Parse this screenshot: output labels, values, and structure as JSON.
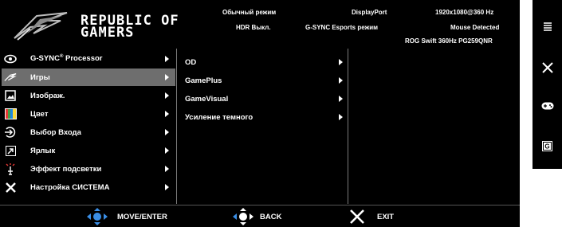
{
  "brand": {
    "line1": "REPUBLIC OF",
    "line2": "GAMERS",
    "logo_icon": "rog-eye-logo-icon"
  },
  "header_info": {
    "mode": "Обычный режим",
    "hdr": "HDR Выкл.",
    "input": "DisplayPort",
    "gsync_mode": "G-SYNC Esports режим",
    "resolution": "1920x1080@360 Hz",
    "mouse": "Mouse Detected",
    "model": "ROG Swift 360Hz PG259QNR"
  },
  "main_menu": [
    {
      "label": "G-SYNC",
      "sup": "®",
      "suffix": " Processor",
      "icon": "gsync-eye-icon",
      "selected": false
    },
    {
      "label": "Игры",
      "icon": "rog-claw-icon",
      "selected": true
    },
    {
      "label": "Изображ.",
      "icon": "image-icon",
      "selected": false
    },
    {
      "label": "Цвет",
      "icon": "color-bars-icon",
      "selected": false
    },
    {
      "label": "Выбор Входа",
      "icon": "input-select-icon",
      "selected": false
    },
    {
      "label": "Ярлык",
      "icon": "shortcut-arrow-icon",
      "selected": false
    },
    {
      "label": "Эффект подсветки",
      "icon": "light-effect-icon",
      "selected": false
    },
    {
      "label": "Настройка СИСТЕМА",
      "icon": "wrench-tools-icon",
      "selected": false
    }
  ],
  "submenu": [
    {
      "label": "OD"
    },
    {
      "label": "GamePlus"
    },
    {
      "label": "GameVisual"
    },
    {
      "label": "Усиление темного"
    }
  ],
  "footer": {
    "move": "MOVE/ENTER",
    "back": "BACK",
    "exit": "EXIT"
  },
  "hotkeys": [
    {
      "icon": "menu-lines-icon"
    },
    {
      "icon": "close-x-icon"
    },
    {
      "icon": "gamepad-icon"
    },
    {
      "icon": "gameplus-g-icon"
    }
  ],
  "colors": {
    "selected_row": "#6e6e6e",
    "joystick_blue": "#3a8ee6",
    "background": "#000000"
  }
}
